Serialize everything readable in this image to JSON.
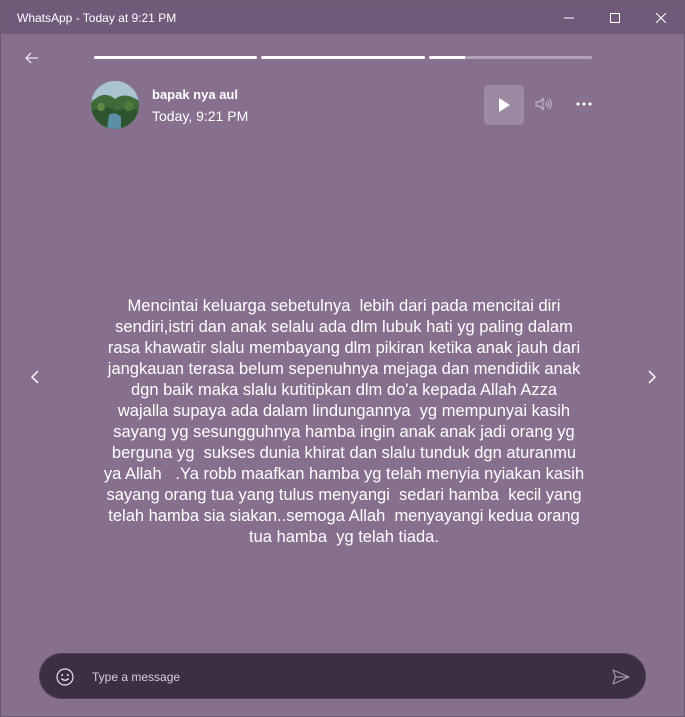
{
  "window": {
    "title": "WhatsApp - Today at 9:21 PM"
  },
  "story": {
    "contact_name": "bapak nya aul",
    "time": "Today, 9:21 PM",
    "progress_segments": [
      1.0,
      1.0,
      0.22
    ],
    "text_lines": [
      "Mencintai keluarga sebetulnya  lebih dari pada mencitai diri",
      "sendiri,istri dan anak selalu ada dlm lubuk hati yg paling dalam",
      "rasa khawatir slalu membayang dlm pikiran ketika anak jauh dari",
      "jangkauan terasa belum sepenuhnya mejaga dan mendidik anak",
      "dgn baik maka slalu kutitipkan dlm do'a kepada Allah Azza",
      "wajalla supaya ada dalam lindungannya  yg mempunyai kasih",
      "sayang yg sesungguhnya hamba ingin anak anak jadi orang yg",
      "berguna yg  sukses dunia khirat dan slalu tunduk dgn aturanmu",
      "ya Allah   .Ya robb maafkan hamba yg telah menyia nyiakan kasih",
      "sayang orang tua yang tulus menyangi  sedari hamba  kecil yang",
      "telah hamba sia siakan..semoga Allah  menyayangi kedua orang",
      "tua hamba  yg telah tiada."
    ]
  },
  "composer": {
    "placeholder": "Type a message"
  },
  "icons": {
    "back": "arrow-left-icon",
    "play": "play-icon",
    "volume": "volume-icon",
    "more": "more-icon",
    "prev": "chevron-left-icon",
    "next": "chevron-right-icon",
    "emoji": "emoji-icon",
    "send": "send-icon"
  },
  "colors": {
    "background": "#86708e",
    "titlebar": "#6f5a79",
    "composer": "#3b2f41"
  }
}
